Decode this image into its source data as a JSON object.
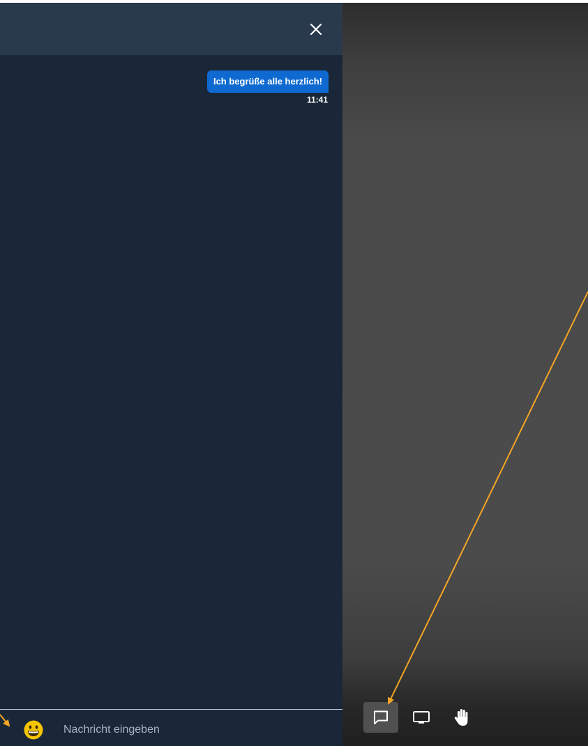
{
  "chat": {
    "close_icon": "close-icon",
    "messages": [
      {
        "text": "Ich begrüße alle herzlich!",
        "time": "11:41"
      }
    ],
    "composer": {
      "emoji_icon": "grinning-face-icon",
      "placeholder": "Nachricht eingeben"
    }
  },
  "toolbar": {
    "buttons": [
      {
        "icon": "chat-icon",
        "active": true
      },
      {
        "icon": "screen-share-icon",
        "active": false
      },
      {
        "icon": "raise-hand-icon",
        "active": false
      }
    ]
  },
  "colors": {
    "panel_bg": "#1a2738",
    "header_bg": "#2a3a4d",
    "bubble_bg": "#0e6ad0",
    "annotation_arrow": "#f5a623"
  }
}
